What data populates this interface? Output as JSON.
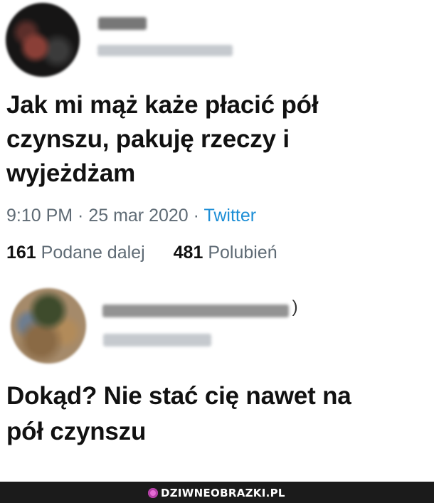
{
  "tweet": {
    "text": "Jak mi mąż każe płacić pół\nczynszu, pakuję rzeczy i\nwyjeżdżam",
    "time": "9:10 PM",
    "separator": " · ",
    "date": "25 mar 2020",
    "source": "Twitter",
    "retweets_count": "161",
    "retweets_label": "Podane dalej",
    "likes_count": "481",
    "likes_label": "Polubień"
  },
  "reply": {
    "name_tail": " )",
    "text": "Dokąd? Nie stać cię nawet na\npół czynszu"
  },
  "footer": {
    "watermark": "DZIWNEOBRAZKI.PL"
  },
  "colors": {
    "meta_gray": "#5f6b75",
    "twitter_blue": "#1c8ed6",
    "footer_bg": "#1b1b1b",
    "watermark_pink": "#e46cd5"
  },
  "icons": {
    "watermark": "brain-icon"
  }
}
